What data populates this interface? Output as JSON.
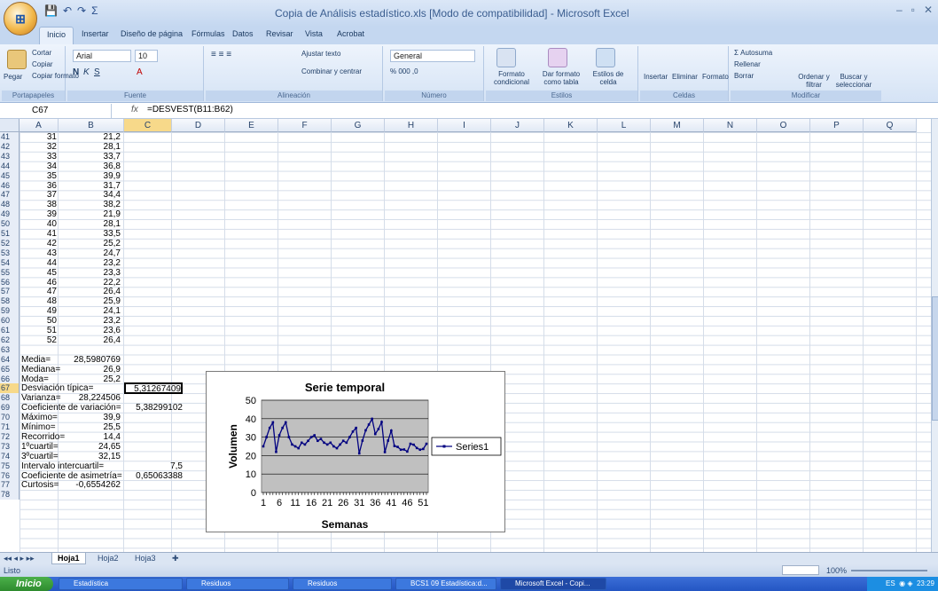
{
  "window": {
    "title": "Copia de Análisis estadístico.xls  [Modo de compatibilidad] - Microsoft Excel"
  },
  "tabs": [
    "Inicio",
    "Insertar",
    "Diseño de página",
    "Fórmulas",
    "Datos",
    "Revisar",
    "Vista",
    "Acrobat"
  ],
  "ribbon": {
    "clipboard": {
      "cut": "Cortar",
      "copy": "Copiar",
      "paste": "Pegar",
      "format_painter": "Copiar formato",
      "label": "Portapapeles"
    },
    "font": {
      "name": "Arial",
      "size": "10",
      "label": "Fuente"
    },
    "alignment": {
      "wrap": "Ajustar texto",
      "merge": "Combinar y centrar",
      "label": "Alineación"
    },
    "number": {
      "format": "General",
      "label": "Número"
    },
    "styles": {
      "conditional": "Formato condicional",
      "table": "Dar formato como tabla",
      "cell": "Estilos de celda",
      "label": "Estilos"
    },
    "cells": {
      "insert": "Insertar",
      "delete": "Eliminar",
      "format": "Formato",
      "label": "Celdas"
    },
    "editing": {
      "autosum": "Autosuma",
      "fill": "Rellenar",
      "clear": "Borrar",
      "sort": "Ordenar y filtrar",
      "find": "Buscar y seleccionar",
      "label": "Modificar"
    }
  },
  "formula_bar": {
    "name_box": "C67",
    "fx": "fx",
    "formula": "=DESVEST(B11:B62)"
  },
  "columns": [
    "A",
    "B",
    "C",
    "D",
    "E",
    "F",
    "G",
    "H",
    "I",
    "J",
    "K",
    "L",
    "M",
    "N",
    "O",
    "P",
    "Q"
  ],
  "data_rows": [
    {
      "row": "41",
      "a": "31",
      "b": "21,2"
    },
    {
      "row": "42",
      "a": "32",
      "b": "28,1"
    },
    {
      "row": "43",
      "a": "33",
      "b": "33,7"
    },
    {
      "row": "44",
      "a": "34",
      "b": "36,8"
    },
    {
      "row": "45",
      "a": "35",
      "b": "39,9"
    },
    {
      "row": "46",
      "a": "36",
      "b": "31,7"
    },
    {
      "row": "47",
      "a": "37",
      "b": "34,4"
    },
    {
      "row": "48",
      "a": "38",
      "b": "38,2"
    },
    {
      "row": "49",
      "a": "39",
      "b": "21,9"
    },
    {
      "row": "50",
      "a": "40",
      "b": "28,1"
    },
    {
      "row": "51",
      "a": "41",
      "b": "33,5"
    },
    {
      "row": "52",
      "a": "42",
      "b": "25,2"
    },
    {
      "row": "53",
      "a": "43",
      "b": "24,7"
    },
    {
      "row": "54",
      "a": "44",
      "b": "23,2"
    },
    {
      "row": "55",
      "a": "45",
      "b": "23,3"
    },
    {
      "row": "56",
      "a": "46",
      "b": "22,2"
    },
    {
      "row": "57",
      "a": "47",
      "b": "26,4"
    },
    {
      "row": "58",
      "a": "48",
      "b": "25,9"
    },
    {
      "row": "59",
      "a": "49",
      "b": "24,1"
    },
    {
      "row": "60",
      "a": "50",
      "b": "23,2"
    },
    {
      "row": "61",
      "a": "51",
      "b": "23,6"
    },
    {
      "row": "62",
      "a": "52",
      "b": "26,4"
    }
  ],
  "stats_rows": [
    {
      "row": "63",
      "label": "",
      "b": "",
      "c": ""
    },
    {
      "row": "64",
      "label": "Media=",
      "b": "28,5980769",
      "c": ""
    },
    {
      "row": "65",
      "label": "Mediana=",
      "b": "26,9",
      "c": ""
    },
    {
      "row": "66",
      "label": "Moda=",
      "b": "25,2",
      "c": ""
    },
    {
      "row": "67",
      "label": "Desviación típica=",
      "b": "",
      "c": "5,31267409"
    },
    {
      "row": "68",
      "label": "Varianza=",
      "b": "28,224506",
      "c": ""
    },
    {
      "row": "69",
      "label": "Coeficiente de variación=",
      "b": "",
      "c": "5,38299102"
    },
    {
      "row": "70",
      "label": "Máximo=",
      "b": "39,9",
      "c": ""
    },
    {
      "row": "71",
      "label": "Mínimo=",
      "b": "25,5",
      "c": ""
    },
    {
      "row": "72",
      "label": "Recorrido=",
      "b": "14,4",
      "c": ""
    },
    {
      "row": "73",
      "label": "1ºcuartil=",
      "b": "24,65",
      "c": ""
    },
    {
      "row": "74",
      "label": "3ºcuartil=",
      "b": "32,15",
      "c": ""
    },
    {
      "row": "75",
      "label": "Intervalo intercuartil=",
      "b": "",
      "c": "7,5"
    },
    {
      "row": "76",
      "label": "Coeficiente de asimetría=",
      "b": "",
      "c": "0,65063388"
    },
    {
      "row": "77",
      "label": "Curtosis=",
      "b": "-0,6554262",
      "c": ""
    },
    {
      "row": "78",
      "label": "",
      "b": "",
      "c": ""
    }
  ],
  "sheets": [
    "Hoja1",
    "Hoja2",
    "Hoja3"
  ],
  "status": {
    "ready": "Listo",
    "zoom": "100%"
  },
  "taskbar": {
    "start": "Inicio",
    "items": [
      "Estadística",
      "Residuos",
      "Residuos",
      "BCS1 09 Estadística:d...",
      "Microsoft Excel - Copi..."
    ],
    "tray_lang": "ES",
    "clock": "23:29"
  },
  "chart_data": {
    "type": "line",
    "title": "Serie temporal",
    "xlabel": "Semanas",
    "ylabel": "Volumen",
    "ylim": [
      0,
      50
    ],
    "yticks": [
      "0",
      "10",
      "20",
      "30",
      "40",
      "50"
    ],
    "xticks": [
      "1",
      "6",
      "11",
      "16",
      "21",
      "26",
      "31",
      "36",
      "41",
      "46",
      "51"
    ],
    "legend": "right",
    "plot_bg": "#c0c0c0",
    "series_color": "#000080",
    "series": [
      {
        "name": "Series1",
        "values": [
          25,
          30,
          35,
          38,
          22,
          31,
          35,
          38,
          30,
          26,
          25,
          24,
          27,
          26,
          28,
          30,
          31,
          28,
          29,
          27,
          26,
          27,
          25,
          24,
          26,
          28,
          27,
          30,
          33,
          35,
          21.2,
          28.1,
          33.7,
          36.8,
          39.9,
          31.7,
          34.4,
          38.2,
          21.9,
          28.1,
          33.5,
          25.2,
          24.7,
          23.2,
          23.3,
          22.2,
          26.4,
          25.9,
          24.1,
          23.2,
          23.6,
          26.4
        ]
      }
    ]
  }
}
